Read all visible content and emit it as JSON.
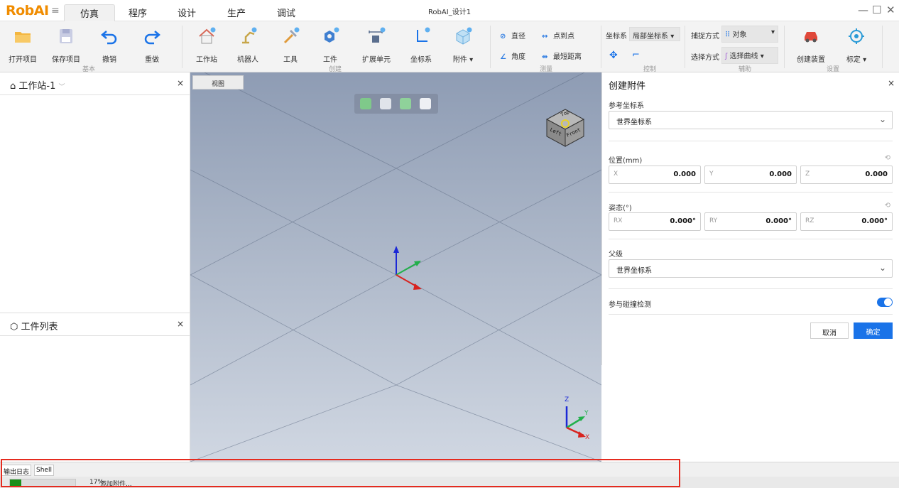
{
  "app": {
    "logo": "RobAI",
    "window_title": "RobAI_设计1",
    "menu_tabs": [
      "仿真",
      "程序",
      "设计",
      "生产",
      "调试"
    ],
    "active_tab": "仿真"
  },
  "ribbon": {
    "basic": {
      "group_label": "基本",
      "items": [
        "打开项目",
        "保存项目",
        "撤销",
        "重做"
      ]
    },
    "create": {
      "group_label": "创建",
      "items": [
        "工作站",
        "机器人",
        "工具",
        "工件",
        "扩展单元",
        "坐标系",
        "附件"
      ]
    },
    "measure": {
      "group_label": "测量",
      "items": [
        "直径",
        "点到点",
        "角度",
        "最短距离"
      ]
    },
    "control": {
      "group_label": "控制",
      "coord_label": "坐标系",
      "coord_value": "局部坐标系"
    },
    "assist": {
      "group_label": "辅助",
      "capture_label": "捕捉方式",
      "capture_value": "对象",
      "select_label": "选择方式",
      "select_value": "选择曲线"
    },
    "settings": {
      "group_label": "设置",
      "items": [
        "创建装置",
        "标定"
      ]
    }
  },
  "left_panels": {
    "station": {
      "title": "工作站-1"
    },
    "parts": {
      "title": "工件列表"
    }
  },
  "viewport": {
    "tab_label": "视图",
    "cube_labels": {
      "top": "Top",
      "left": "Left",
      "front": "Front"
    },
    "axis_labels": {
      "x": "X",
      "y": "Y",
      "z": "Z"
    }
  },
  "create_attachment": {
    "title": "创建附件",
    "ref_coord_label": "参考坐标系",
    "ref_coord_value": "世界坐标系",
    "position_label": "位置(mm)",
    "position": [
      {
        "axis": "X",
        "value": "0.000"
      },
      {
        "axis": "Y",
        "value": "0.000"
      },
      {
        "axis": "Z",
        "value": "0.000"
      }
    ],
    "orientation_label": "姿态(°)",
    "orientation": [
      {
        "axis": "RX",
        "value": "0.000°"
      },
      {
        "axis": "RY",
        "value": "0.000°"
      },
      {
        "axis": "RZ",
        "value": "0.000°"
      }
    ],
    "parent_label": "父级",
    "parent_value": "世界坐标系",
    "collision_label": "参与碰撞检测",
    "collision_enabled": true,
    "cancel_label": "取消",
    "ok_label": "确定"
  },
  "bottom": {
    "tabs": [
      "输出日志",
      "Shell"
    ],
    "progress_percent": 17,
    "progress_text": "17%",
    "status_text": "添加附件..."
  },
  "colors": {
    "accent": "#1a73e8",
    "logo": "#f08c00",
    "progress": "#1a8f1a",
    "highlight": "#e52b1f"
  }
}
